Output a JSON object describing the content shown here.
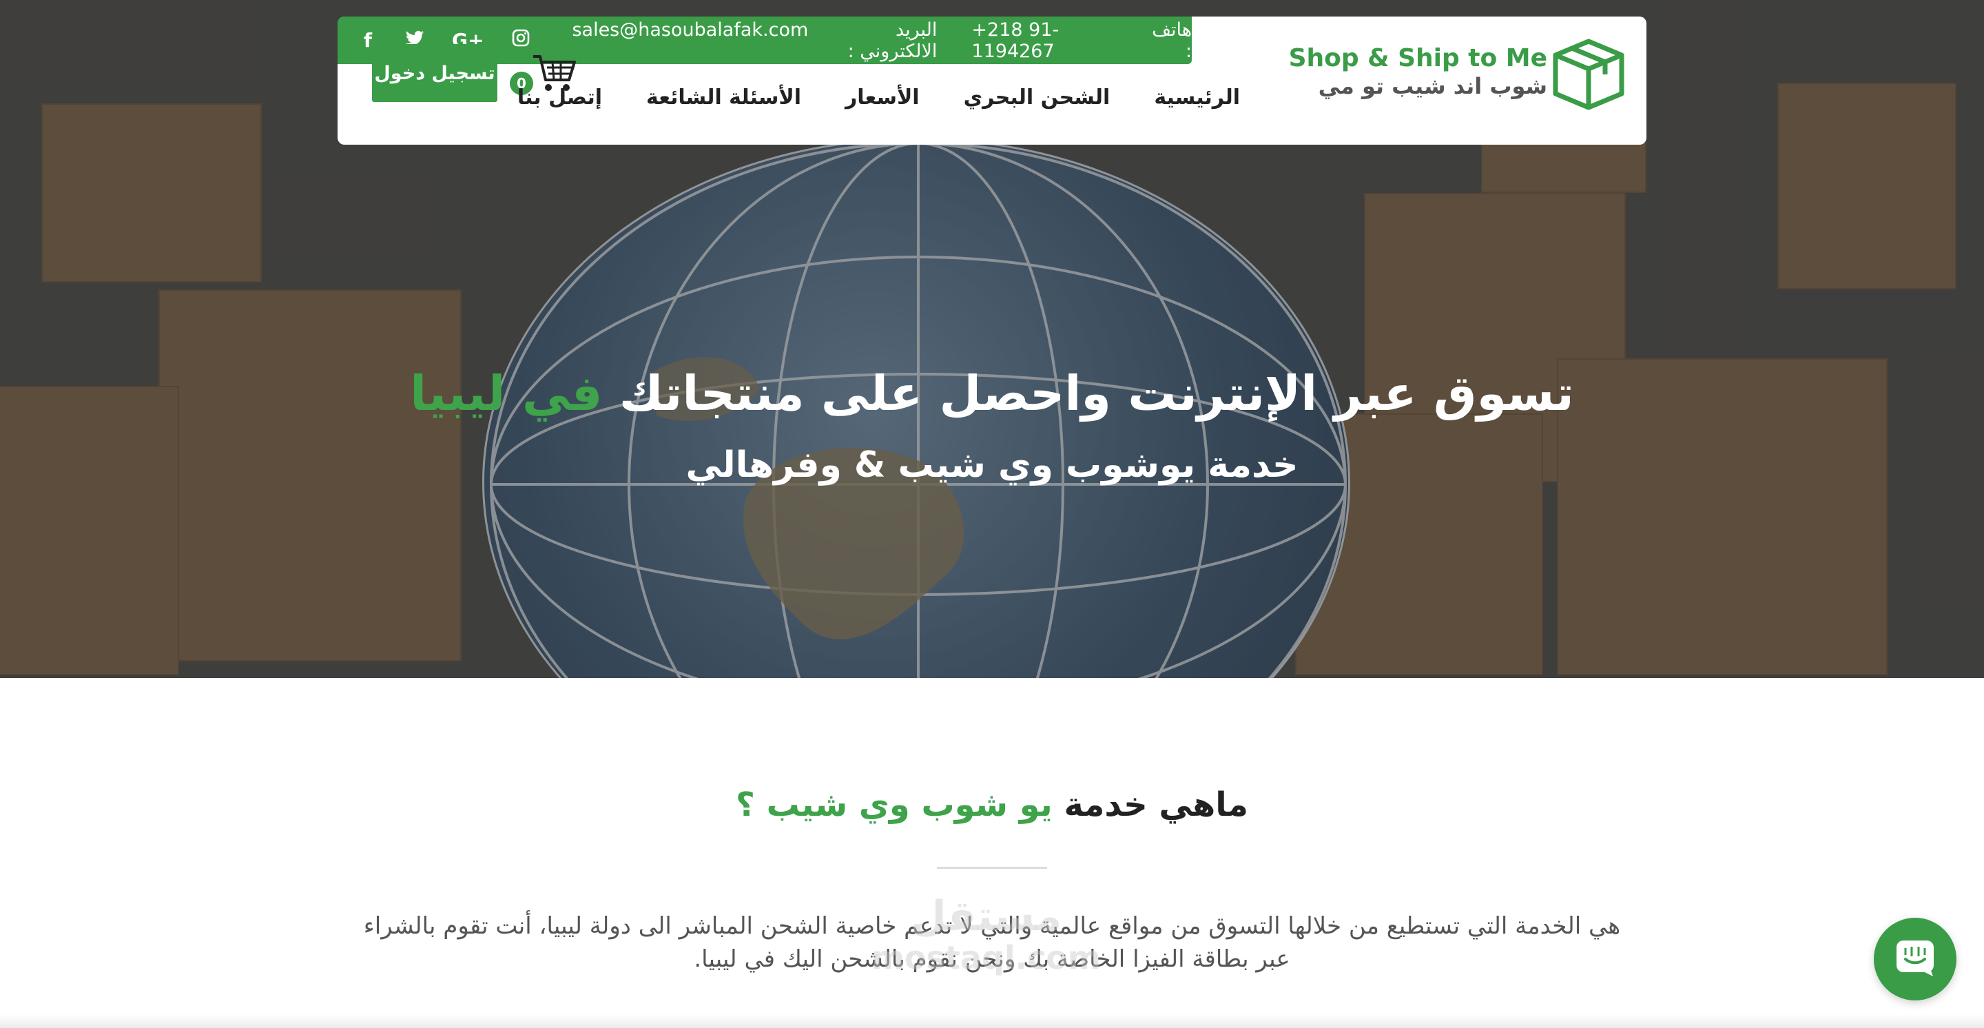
{
  "hero": {
    "title_main": "تسوق عبر الإنترنت واحصل على منتجاتك ",
    "title_accent": "في ليبيا",
    "subtitle": "خدمة يوشوب وي شيب & وفرهالي"
  },
  "topbar": {
    "phone_label": "هاتف :",
    "phone": "+218 91-1194267",
    "email_label": "البريد الالكتروني :",
    "email": "sales@hasoubalafak.com",
    "social_icons": [
      "instagram-icon",
      "google-plus-icon",
      "twitter-icon",
      "facebook-icon"
    ],
    "google_plus_glyph": "G+",
    "facebook_glyph": "f"
  },
  "nav": {
    "items": [
      "الرئيسية",
      "الشحن البحري",
      "الأسعار",
      "الأسئلة الشائعة",
      "إتصل بنا"
    ],
    "cart_count": "0",
    "login_label": "تسجيل دخول"
  },
  "logo": {
    "text_en": "Shop & Ship to Me",
    "text_ar": "شوب اند شيب تو مي"
  },
  "section": {
    "title_main": "ماهي خدمة ",
    "title_accent": "يو شوب وي شيب ؟",
    "text": "هي الخدمة التي تستطيع من خلالها التسوق من مواقع عالمية والتي لا تدعم خاصية الشحن المباشر الى دولة ليبيا، أنت تقوم بالشراء عبر بطاقة الفيزا الخاصة بك ونحن نقوم بالشحن اليك في ليبيا."
  },
  "watermark": {
    "line1": "مستقل",
    "line2": "mostaql.com"
  },
  "colors": {
    "accent": "#3a9c47",
    "hero_overlay": "#4b4a48"
  }
}
